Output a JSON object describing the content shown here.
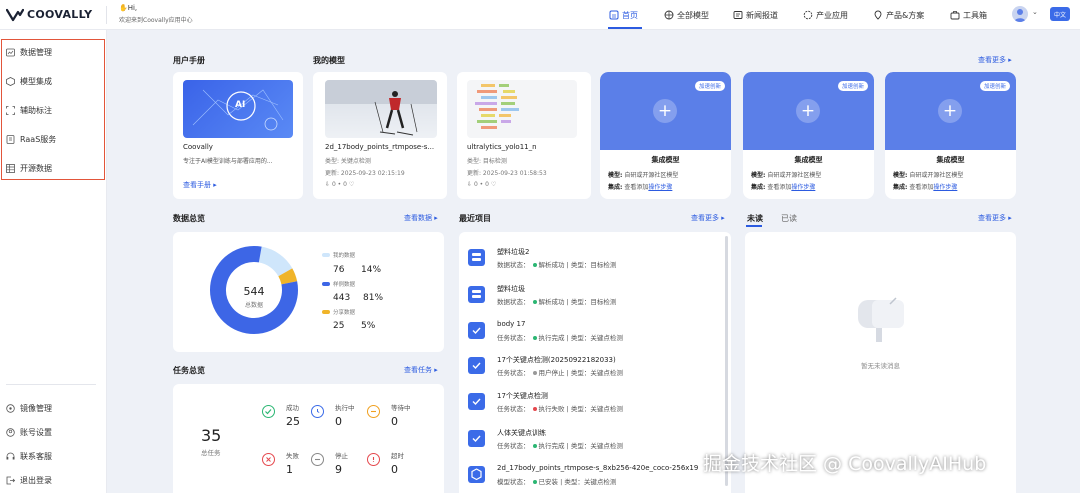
{
  "header": {
    "logo_text": "COOVALLY",
    "greeting_hi": "Hi,",
    "greeting_sub": "欢迎来到Coovally应用中心",
    "nav": [
      {
        "label": "首页",
        "active": true
      },
      {
        "label": "全部模型"
      },
      {
        "label": "新闻报道"
      },
      {
        "label": "产业应用"
      },
      {
        "label": "产品&方案"
      },
      {
        "label": "工具箱"
      }
    ],
    "lang": "中文"
  },
  "sidebar": {
    "top_items": [
      {
        "label": "数据管理",
        "icon": "database-icon"
      },
      {
        "label": "模型集成",
        "icon": "cube-icon"
      },
      {
        "label": "辅助标注",
        "icon": "frame-icon"
      },
      {
        "label": "RaaS服务",
        "icon": "service-icon"
      },
      {
        "label": "开源数据",
        "icon": "table-icon"
      }
    ],
    "bottom_items": [
      {
        "label": "镜像管理",
        "icon": "mirror-icon"
      },
      {
        "label": "账号设置",
        "icon": "user-icon"
      },
      {
        "label": "联系客服",
        "icon": "headset-icon"
      },
      {
        "label": "退出登录",
        "icon": "logout-icon"
      }
    ]
  },
  "manual": {
    "title": "用户手册",
    "card_name": "Coovally",
    "card_desc": "专注于AI模型训练与部署应用的...",
    "link": "查看手册",
    "thumb_text": "AI"
  },
  "my_models": {
    "title": "我的模型",
    "more": "查看更多",
    "items": [
      {
        "name": "2d_17body_points_rtmpose-s...",
        "type": "类型: 关键点检测",
        "updated": "更新: 2025-09-23 02:15:19",
        "stats": "0  •  0"
      },
      {
        "name": "ultralytics_yolo11_n",
        "type": "类型: 目标检测",
        "updated": "更新: 2025-09-23 01:58:53",
        "stats": "0  •  0"
      }
    ]
  },
  "integrations": [
    {
      "badge": "加速创新",
      "title": "集成模型",
      "model_label": "模型:",
      "model_value": "自研或开源社区模型",
      "int_label": "集成:",
      "int_value": "查看添加",
      "int_link": "操作步骤"
    },
    {
      "badge": "加速创新",
      "title": "集成模型",
      "model_label": "模型:",
      "model_value": "自研或开源社区模型",
      "int_label": "集成:",
      "int_value": "查看添加",
      "int_link": "操作步骤"
    },
    {
      "badge": "加速创新",
      "title": "集成模型",
      "model_label": "模型:",
      "model_value": "自研或开源社区模型",
      "int_label": "集成:",
      "int_value": "查看添加",
      "int_link": "操作步骤"
    }
  ],
  "data_overview": {
    "title": "数据总览",
    "more": "查看数据",
    "total": "544",
    "total_label": "总数据",
    "items": [
      {
        "label": "我的数据",
        "value": "76",
        "pct": "14%",
        "color": "#cfe6fb",
        "fraction": 0.14
      },
      {
        "label": "样例数据",
        "value": "443",
        "pct": "81%",
        "color": "#3d66e6",
        "fraction": 0.81
      },
      {
        "label": "分享数据",
        "value": "25",
        "pct": "5%",
        "color": "#f0b429",
        "fraction": 0.05
      }
    ]
  },
  "task_overview": {
    "title": "任务总览",
    "more": "查看任务",
    "total": "35",
    "total_label": "总任务",
    "items": [
      {
        "label": "成功",
        "value": "25",
        "color": "#2bb673",
        "icon": "check-icon"
      },
      {
        "label": "执行中",
        "value": "0",
        "color": "#3b6be8",
        "icon": "clock-icon"
      },
      {
        "label": "等待中",
        "value": "0",
        "color": "#f0a020",
        "icon": "wait-icon"
      },
      {
        "label": "失败",
        "value": "1",
        "color": "#e5484d",
        "icon": "x-icon"
      },
      {
        "label": "停止",
        "value": "9",
        "color": "#888888",
        "icon": "stop-icon"
      },
      {
        "label": "超时",
        "value": "0",
        "color": "#e5484d",
        "icon": "alert-icon"
      }
    ]
  },
  "recent_projects": {
    "title": "最近项目",
    "more": "查看更多",
    "items": [
      {
        "title": "塑料垃圾2",
        "prefix": "数据状态：",
        "status": "解析成功",
        "status_color": "#2bb673",
        "suffix": "| 类型：目标检测"
      },
      {
        "title": "塑料垃圾",
        "prefix": "数据状态：",
        "status": "解析成功",
        "status_color": "#2bb673",
        "suffix": "| 类型：目标检测"
      },
      {
        "title": "body 17",
        "prefix": "任务状态：",
        "status": "执行完成",
        "status_color": "#2bb673",
        "suffix": "| 类型：关键点检测"
      },
      {
        "title": "17个关键点检测(20250922182033)",
        "prefix": "任务状态：",
        "status": "用户停止",
        "status_color": "#999999",
        "suffix": "| 类型：关键点检测"
      },
      {
        "title": "17个关键点检测",
        "prefix": "任务状态：",
        "status": "执行失败",
        "status_color": "#e5484d",
        "suffix": "| 类型：关键点检测"
      },
      {
        "title": "人体关键点训练",
        "prefix": "任务状态：",
        "status": "执行完成",
        "status_color": "#2bb673",
        "suffix": "| 类型：关键点检测"
      },
      {
        "title": "2d_17body_points_rtmpose-s_8xb256-420e_coco-256x19",
        "prefix": "模型状态：",
        "status": "已安装",
        "status_color": "#2bb673",
        "suffix": "| 类型：关键点检测"
      }
    ]
  },
  "messages": {
    "tab_unread": "未读",
    "tab_read": "已读",
    "more": "查看更多",
    "empty_text": "暂无未读消息"
  },
  "watermark": "掘金技术社区 @ CoovallyAIHub"
}
